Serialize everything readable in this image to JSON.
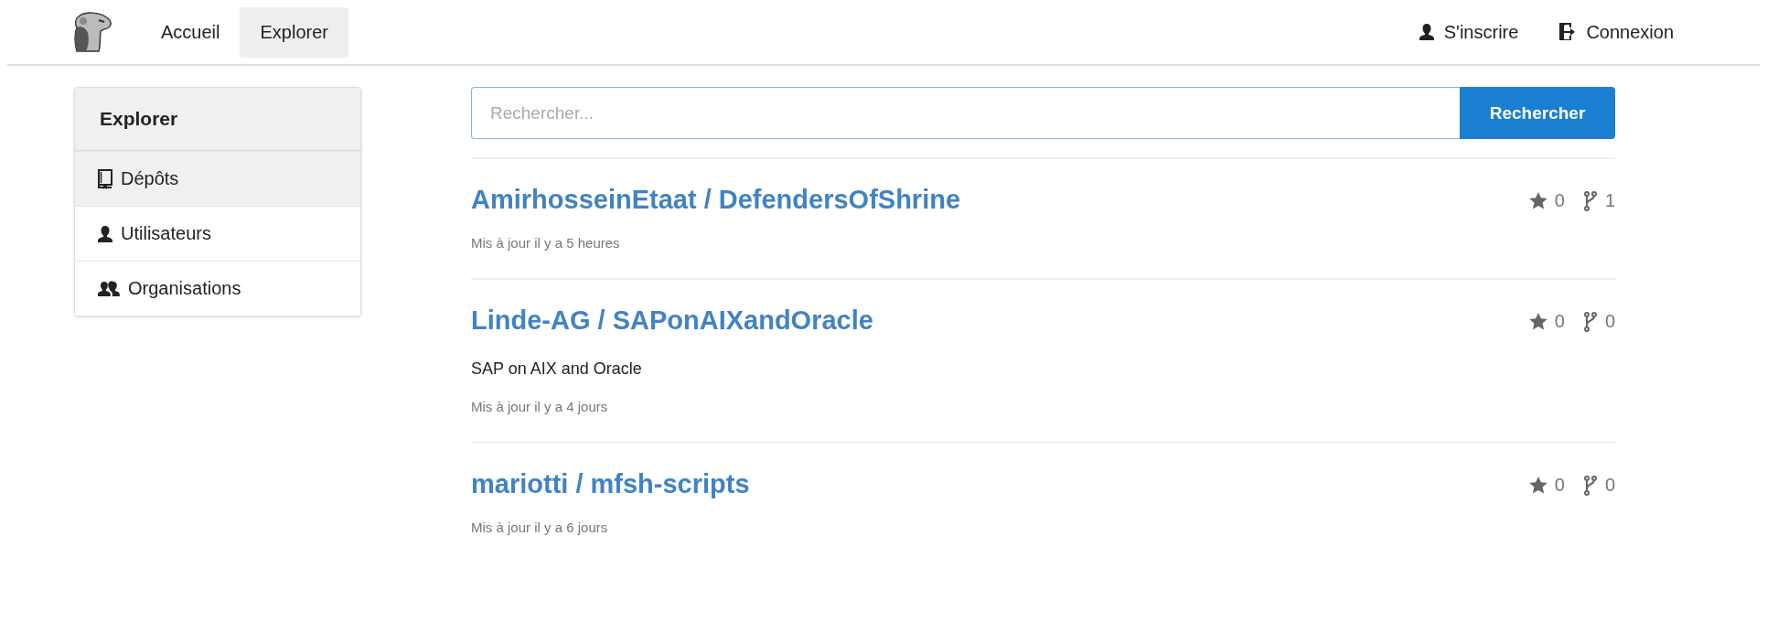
{
  "nav": {
    "items": [
      {
        "label": "Accueil",
        "selected": false
      },
      {
        "label": "Explorer",
        "selected": true
      }
    ],
    "right_items": [
      {
        "label": "S'inscrire",
        "kind": "signup"
      },
      {
        "label": "Connexion",
        "kind": "signin"
      }
    ]
  },
  "sidebar": {
    "title": "Explorer",
    "items": [
      {
        "label": "Dépôts",
        "kind": "repos",
        "selected": true
      },
      {
        "label": "Utilisateurs",
        "kind": "users",
        "selected": false
      },
      {
        "label": "Organisations",
        "kind": "orgs",
        "selected": false
      }
    ]
  },
  "search": {
    "placeholder": "Rechercher...",
    "button": "Rechercher"
  },
  "repos": [
    {
      "name": "AmirhosseinEtaat / DefendersOfShrine",
      "stars": "0",
      "forks": "1",
      "updated": "Mis à jour il y a 5 heures"
    },
    {
      "name": "Linde-AG / SAPonAIXandOracle",
      "stars": "0",
      "forks": "0",
      "description": "SAP on AIX and Oracle",
      "updated": "Mis à jour il y a 4 jours"
    },
    {
      "name": "mariotti / mfsh-scripts",
      "stars": "0",
      "forks": "0",
      "updated": "Mis à jour il y a 6 jours"
    }
  ]
}
